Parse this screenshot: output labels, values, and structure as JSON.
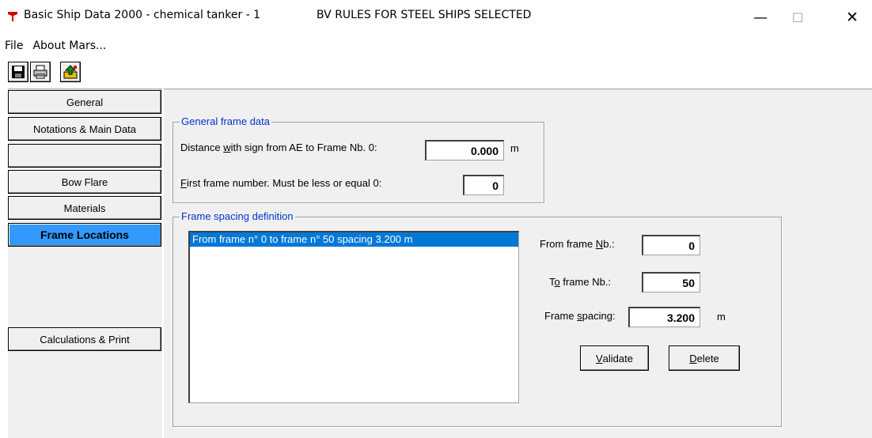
{
  "window": {
    "title": "Basic Ship Data 2000 - chemical tanker - 1",
    "rules_banner": "BV RULES FOR STEEL SHIPS SELECTED",
    "controls": {
      "minimize": "—",
      "maximize": "☐",
      "close": "✕"
    }
  },
  "menu": {
    "items": [
      "File",
      "About Mars..."
    ]
  },
  "toolbar": {
    "buttons": [
      "save-icon",
      "print-icon",
      "export-icon"
    ]
  },
  "nav": {
    "items": [
      {
        "label": "General",
        "active": false
      },
      {
        "label": "Notations & Main Data",
        "active": false
      },
      {
        "label": "",
        "active": false
      },
      {
        "label": "Bow Flare",
        "active": false
      },
      {
        "label": "Materials",
        "active": false
      },
      {
        "label": "Frame Locations",
        "active": true
      },
      {
        "label": "Calculations & Print",
        "active": false
      }
    ]
  },
  "general_frame": {
    "title": "General frame data",
    "distance": {
      "label_pre": "Distance ",
      "label_ul": "w",
      "label_post": "ith sign from AE to Frame Nb. 0:",
      "value": "0.000",
      "unit": "m"
    },
    "first_frame": {
      "label_ul": "F",
      "label_post": "irst frame number. Must be less or equal 0:",
      "value": "0"
    }
  },
  "frame_spacing": {
    "title": "Frame spacing definition",
    "list": [
      "From frame n° 0 to frame n° 50 spacing 3.200 m"
    ],
    "from": {
      "label_pre": "From frame ",
      "label_ul": "N",
      "label_post": "b.:",
      "value": "0"
    },
    "to": {
      "label_pre": "T",
      "label_ul": "o",
      "label_post": " frame Nb.:",
      "value": "50"
    },
    "spacing": {
      "label_pre": "Frame ",
      "label_ul": "s",
      "label_post": "pacing:",
      "value": "3.200",
      "unit": "m"
    },
    "validate": {
      "ul": "V",
      "rest": "alidate"
    },
    "delete": {
      "ul": "D",
      "rest": "elete"
    }
  },
  "colors": {
    "accent": "#3399ff",
    "selection": "#0078d7",
    "group_title": "#0033cc",
    "panel": "#f0f0f0"
  }
}
